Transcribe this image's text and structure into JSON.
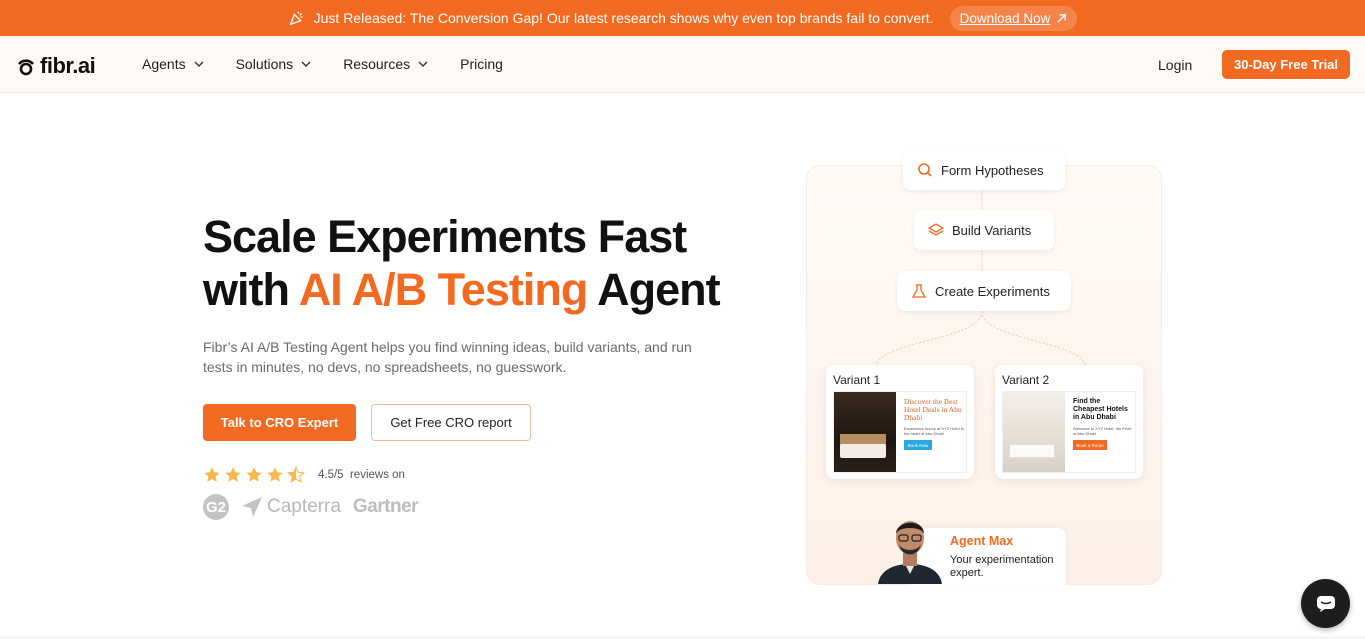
{
  "banner": {
    "icon": "party-popper-icon",
    "text": "Just Released: The Conversion Gap! Our latest research shows why even top brands fail to convert.",
    "cta": "Download Now"
  },
  "nav": {
    "logo": "fibr.ai",
    "items": [
      {
        "label": "Agents",
        "has_dropdown": true
      },
      {
        "label": "Solutions",
        "has_dropdown": true
      },
      {
        "label": "Resources",
        "has_dropdown": true
      },
      {
        "label": "Pricing",
        "has_dropdown": false
      }
    ],
    "login": "Login",
    "trial": "30-Day Free Trial"
  },
  "hero": {
    "title_line1": "Scale Experiments Fast",
    "title_line2_prefix": "with ",
    "title_line2_accent": "AI A/B Testing",
    "title_line2_suffix": " Agent",
    "description": "Fibr’s AI A/B Testing Agent helps you find winning ideas, build variants, and run tests in minutes, no devs, no spreadsheets, no guesswork.",
    "primary_cta": "Talk to CRO Expert",
    "secondary_cta": "Get Free CRO report",
    "rating_value": "4.5/5",
    "rating_suffix": "reviews on",
    "stars": 4.5,
    "review_sites": [
      "G2",
      "Capterra",
      "Gartner"
    ]
  },
  "workflow": {
    "steps": [
      "Form Hypotheses",
      "Build Variants",
      "Create Experiments"
    ],
    "variant1": {
      "label": "Variant 1",
      "headline": "Discover the Best Hotel Deals in Abu Dhabi",
      "sub": "Experience luxury at XYZ Hotel in the heart of Abu Dhabi",
      "button": "Book Now"
    },
    "variant2": {
      "label": "Variant 2",
      "headline": "Find the Cheapest Hotels in Abu Dhabi",
      "sub": "Welcome to XYZ Hotel, the Pride of Abu Dhabi",
      "button": "Book a Room"
    },
    "agent": {
      "name": "Agent Max",
      "description": "Your experimentation expert."
    }
  },
  "colors": {
    "accent": "#f26a21",
    "chat_bubble": "#1d1d1f"
  }
}
